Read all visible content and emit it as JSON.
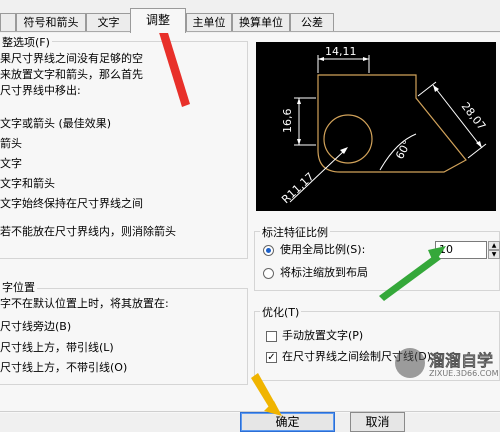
{
  "tabs": [
    "符号和箭头",
    "文字",
    "调整",
    "主单位",
    "换算单位",
    "公差"
  ],
  "fit_options": {
    "title": "整选项(F)",
    "description": [
      "果尺寸界线之间没有足够的空",
      "来放置文字和箭头，那么首先",
      "尺寸界线中移出:"
    ],
    "options": [
      "文字或箭头 (最佳效果)",
      "箭头",
      "文字",
      "文字和箭头",
      "文字始终保持在尺寸界线之间"
    ],
    "suppress_arrows": "若不能放在尺寸界线内，则消除箭头"
  },
  "text_placement": {
    "title": "字位置",
    "description": "字不在默认位置上时，将其放置在:",
    "options": [
      "尺寸线旁边(B)",
      "尺寸线上方，带引线(L)",
      "尺寸线上方，不带引线(O)"
    ]
  },
  "preview": {
    "dims": [
      "14,11",
      "16,6",
      "28,07",
      "60°",
      "R11,17"
    ]
  },
  "scale_for_features": {
    "title": "标注特征比例",
    "use_overall": "使用全局比例(S):",
    "overall_value": "10",
    "scale_to_layout": "将标注缩放到布局"
  },
  "fine_tuning": {
    "title": "优化(T)",
    "place_manually": "手动放置文字(P)",
    "draw_between": "在尺寸界线之间绘制尺寸线(D)"
  },
  "buttons": {
    "ok": "确定",
    "cancel": "取消"
  },
  "watermark": {
    "brand": "溜溜自学",
    "url": "ZIXUE.3D66.COM"
  }
}
